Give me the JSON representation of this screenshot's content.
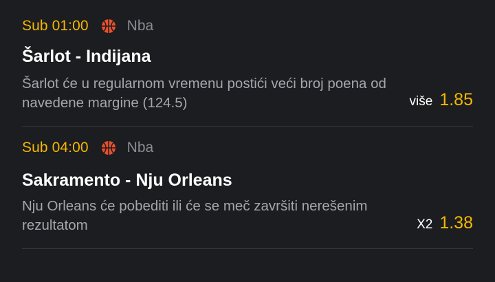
{
  "tips": [
    {
      "time": "Sub 01:00",
      "sport_icon": "basketball-icon",
      "league": "Nba",
      "match": "Šarlot - Indijana",
      "description": "Šarlot će u regularnom vremenu postići veći broj poena od navedene margine (124.5)",
      "bet_type": "više",
      "odd": "1.85"
    },
    {
      "time": "Sub 04:00",
      "sport_icon": "basketball-icon",
      "league": "Nba",
      "match": "Sakramento - Nju Orleans",
      "description": "Nju Orleans će pobediti ili će se meč završiti nerešenim rezultatom",
      "bet_type": "X2",
      "odd": "1.38"
    }
  ],
  "colors": {
    "background": "#1c1d20",
    "accent": "#f5b800",
    "title": "#ffffff",
    "description": "#a4a6ac",
    "league": "#8b8d93",
    "ball": "#e8502d",
    "divider": "#34363b"
  }
}
